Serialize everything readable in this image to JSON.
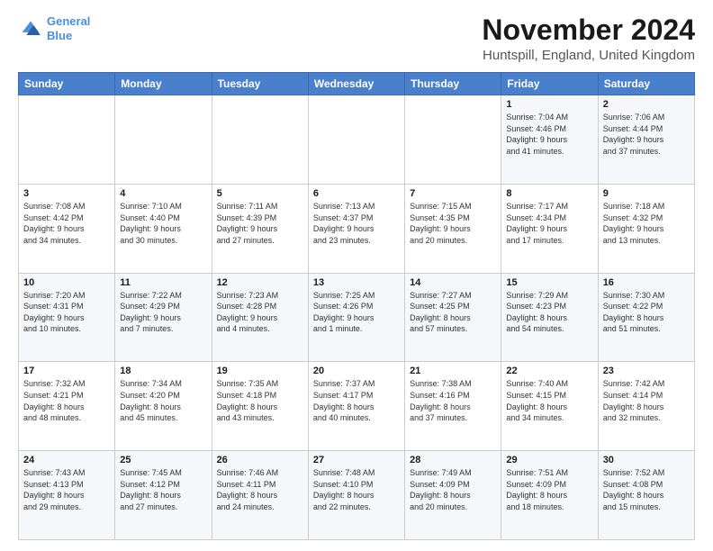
{
  "logo": {
    "line1": "General",
    "line2": "Blue"
  },
  "title": "November 2024",
  "subtitle": "Huntspill, England, United Kingdom",
  "weekdays": [
    "Sunday",
    "Monday",
    "Tuesday",
    "Wednesday",
    "Thursday",
    "Friday",
    "Saturday"
  ],
  "weeks": [
    [
      {
        "day": "",
        "info": ""
      },
      {
        "day": "",
        "info": ""
      },
      {
        "day": "",
        "info": ""
      },
      {
        "day": "",
        "info": ""
      },
      {
        "day": "",
        "info": ""
      },
      {
        "day": "1",
        "info": "Sunrise: 7:04 AM\nSunset: 4:46 PM\nDaylight: 9 hours\nand 41 minutes."
      },
      {
        "day": "2",
        "info": "Sunrise: 7:06 AM\nSunset: 4:44 PM\nDaylight: 9 hours\nand 37 minutes."
      }
    ],
    [
      {
        "day": "3",
        "info": "Sunrise: 7:08 AM\nSunset: 4:42 PM\nDaylight: 9 hours\nand 34 minutes."
      },
      {
        "day": "4",
        "info": "Sunrise: 7:10 AM\nSunset: 4:40 PM\nDaylight: 9 hours\nand 30 minutes."
      },
      {
        "day": "5",
        "info": "Sunrise: 7:11 AM\nSunset: 4:39 PM\nDaylight: 9 hours\nand 27 minutes."
      },
      {
        "day": "6",
        "info": "Sunrise: 7:13 AM\nSunset: 4:37 PM\nDaylight: 9 hours\nand 23 minutes."
      },
      {
        "day": "7",
        "info": "Sunrise: 7:15 AM\nSunset: 4:35 PM\nDaylight: 9 hours\nand 20 minutes."
      },
      {
        "day": "8",
        "info": "Sunrise: 7:17 AM\nSunset: 4:34 PM\nDaylight: 9 hours\nand 17 minutes."
      },
      {
        "day": "9",
        "info": "Sunrise: 7:18 AM\nSunset: 4:32 PM\nDaylight: 9 hours\nand 13 minutes."
      }
    ],
    [
      {
        "day": "10",
        "info": "Sunrise: 7:20 AM\nSunset: 4:31 PM\nDaylight: 9 hours\nand 10 minutes."
      },
      {
        "day": "11",
        "info": "Sunrise: 7:22 AM\nSunset: 4:29 PM\nDaylight: 9 hours\nand 7 minutes."
      },
      {
        "day": "12",
        "info": "Sunrise: 7:23 AM\nSunset: 4:28 PM\nDaylight: 9 hours\nand 4 minutes."
      },
      {
        "day": "13",
        "info": "Sunrise: 7:25 AM\nSunset: 4:26 PM\nDaylight: 9 hours\nand 1 minute."
      },
      {
        "day": "14",
        "info": "Sunrise: 7:27 AM\nSunset: 4:25 PM\nDaylight: 8 hours\nand 57 minutes."
      },
      {
        "day": "15",
        "info": "Sunrise: 7:29 AM\nSunset: 4:23 PM\nDaylight: 8 hours\nand 54 minutes."
      },
      {
        "day": "16",
        "info": "Sunrise: 7:30 AM\nSunset: 4:22 PM\nDaylight: 8 hours\nand 51 minutes."
      }
    ],
    [
      {
        "day": "17",
        "info": "Sunrise: 7:32 AM\nSunset: 4:21 PM\nDaylight: 8 hours\nand 48 minutes."
      },
      {
        "day": "18",
        "info": "Sunrise: 7:34 AM\nSunset: 4:20 PM\nDaylight: 8 hours\nand 45 minutes."
      },
      {
        "day": "19",
        "info": "Sunrise: 7:35 AM\nSunset: 4:18 PM\nDaylight: 8 hours\nand 43 minutes."
      },
      {
        "day": "20",
        "info": "Sunrise: 7:37 AM\nSunset: 4:17 PM\nDaylight: 8 hours\nand 40 minutes."
      },
      {
        "day": "21",
        "info": "Sunrise: 7:38 AM\nSunset: 4:16 PM\nDaylight: 8 hours\nand 37 minutes."
      },
      {
        "day": "22",
        "info": "Sunrise: 7:40 AM\nSunset: 4:15 PM\nDaylight: 8 hours\nand 34 minutes."
      },
      {
        "day": "23",
        "info": "Sunrise: 7:42 AM\nSunset: 4:14 PM\nDaylight: 8 hours\nand 32 minutes."
      }
    ],
    [
      {
        "day": "24",
        "info": "Sunrise: 7:43 AM\nSunset: 4:13 PM\nDaylight: 8 hours\nand 29 minutes."
      },
      {
        "day": "25",
        "info": "Sunrise: 7:45 AM\nSunset: 4:12 PM\nDaylight: 8 hours\nand 27 minutes."
      },
      {
        "day": "26",
        "info": "Sunrise: 7:46 AM\nSunset: 4:11 PM\nDaylight: 8 hours\nand 24 minutes."
      },
      {
        "day": "27",
        "info": "Sunrise: 7:48 AM\nSunset: 4:10 PM\nDaylight: 8 hours\nand 22 minutes."
      },
      {
        "day": "28",
        "info": "Sunrise: 7:49 AM\nSunset: 4:09 PM\nDaylight: 8 hours\nand 20 minutes."
      },
      {
        "day": "29",
        "info": "Sunrise: 7:51 AM\nSunset: 4:09 PM\nDaylight: 8 hours\nand 18 minutes."
      },
      {
        "day": "30",
        "info": "Sunrise: 7:52 AM\nSunset: 4:08 PM\nDaylight: 8 hours\nand 15 minutes."
      }
    ]
  ]
}
